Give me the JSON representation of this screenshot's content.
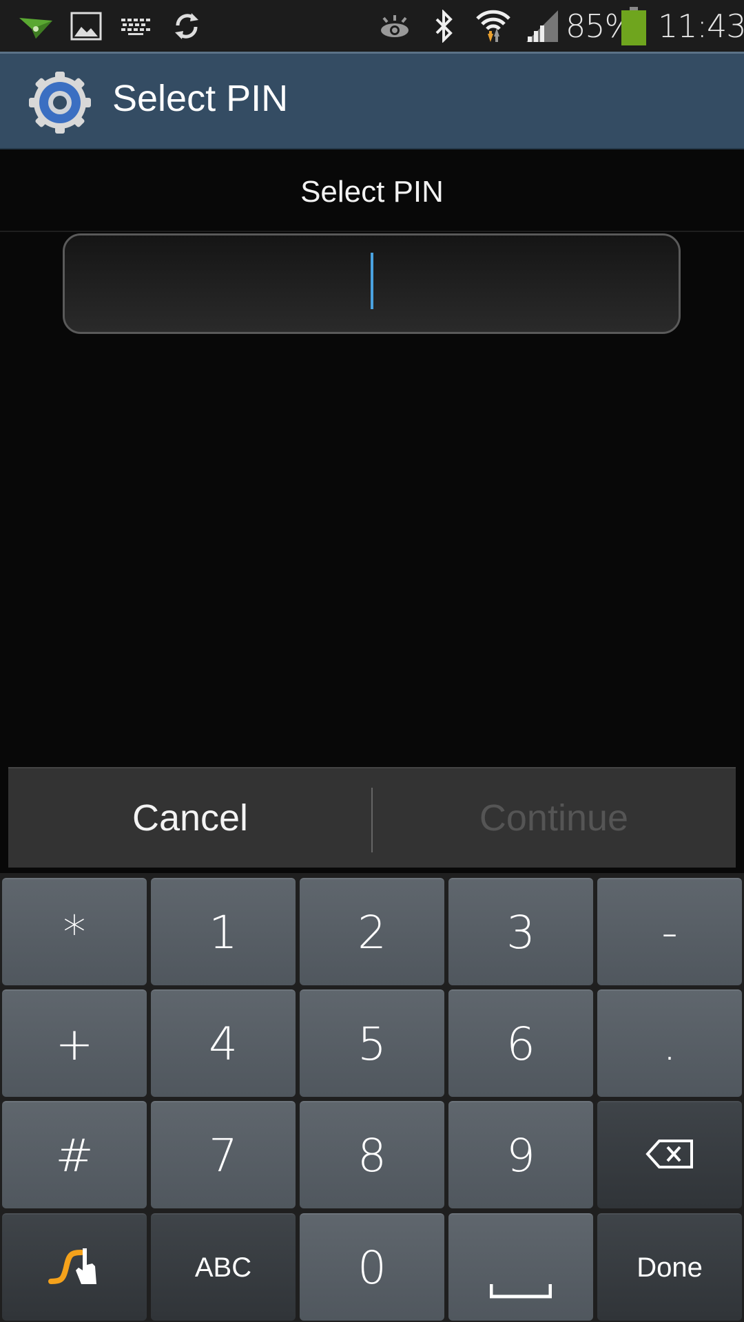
{
  "status_bar": {
    "left_icons": [
      "airdroid-icon",
      "image-icon",
      "keyboard-icon",
      "sync-icon"
    ],
    "right_icons": [
      "smart-stay-eye-icon",
      "bluetooth-icon",
      "wifi-icon",
      "signal-icon"
    ],
    "battery_percent": "85%",
    "battery_color": "#6fa51e",
    "time": "11:43"
  },
  "action_bar": {
    "icon": "settings-gear-icon",
    "title": "Select PIN",
    "background": "#344c63"
  },
  "dialog": {
    "heading": "Select PIN",
    "pin_input": {
      "value": "",
      "placeholder": ""
    },
    "cursor_color": "#4aa2e0",
    "cancel_label": "Cancel",
    "continue_label": "Continue",
    "continue_enabled": false
  },
  "keyboard": {
    "rows": [
      [
        {
          "label": "*",
          "name": "key-asterisk"
        },
        {
          "label": "1",
          "name": "key-1"
        },
        {
          "label": "2",
          "name": "key-2"
        },
        {
          "label": "3",
          "name": "key-3"
        },
        {
          "label": "-",
          "name": "key-minus"
        }
      ],
      [
        {
          "label": "+",
          "name": "key-plus"
        },
        {
          "label": "4",
          "name": "key-4"
        },
        {
          "label": "5",
          "name": "key-5"
        },
        {
          "label": "6",
          "name": "key-6"
        },
        {
          "label": ".",
          "name": "key-period"
        }
      ],
      [
        {
          "label": "#",
          "name": "key-hash"
        },
        {
          "label": "7",
          "name": "key-7"
        },
        {
          "label": "8",
          "name": "key-8"
        },
        {
          "label": "9",
          "name": "key-9"
        },
        {
          "label": "",
          "name": "key-backspace",
          "icon": "backspace-icon"
        }
      ],
      [
        {
          "label": "",
          "name": "key-swype",
          "icon": "swype-icon"
        },
        {
          "label": "ABC",
          "name": "key-abc"
        },
        {
          "label": "0",
          "name": "key-0"
        },
        {
          "label": "",
          "name": "key-space",
          "icon": "space-icon"
        },
        {
          "label": "Done",
          "name": "key-done"
        }
      ]
    ]
  }
}
